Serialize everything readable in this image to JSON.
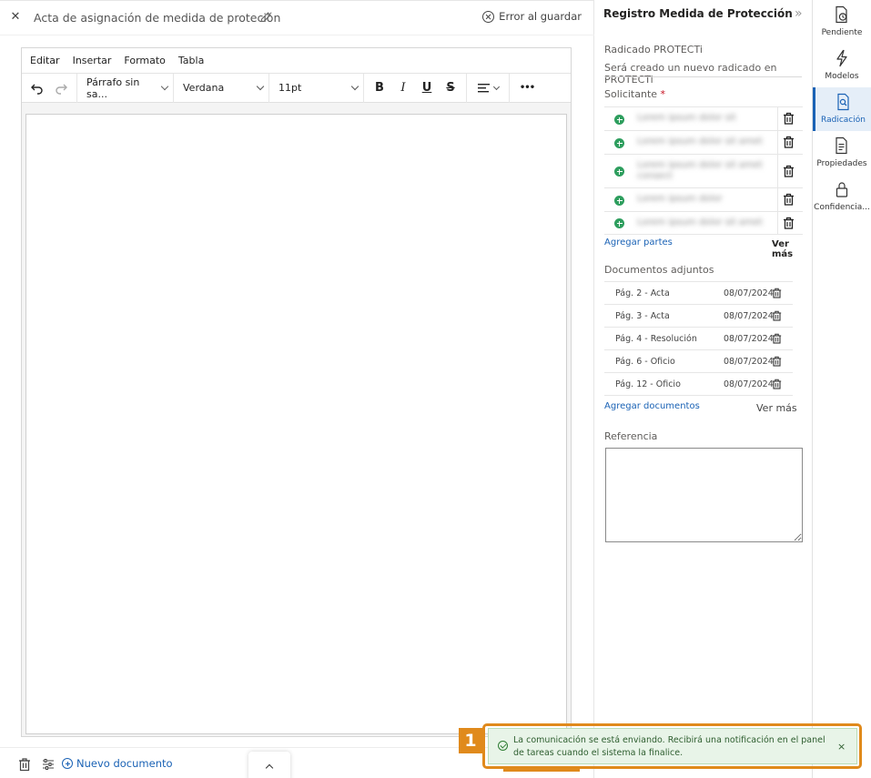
{
  "header": {
    "close_icon": "close-icon",
    "title": "Acta de asignación de medida de proteción",
    "edit_icon": "pencil-icon",
    "save_error": "Error al guardar"
  },
  "editor": {
    "menu": [
      "Editar",
      "Insertar",
      "Formato",
      "Tabla"
    ],
    "paragraph_style": "Párrafo sin sa...",
    "font_family": "Verdana",
    "font_size": "11pt",
    "bold": "B",
    "italic": "I",
    "underline": "U",
    "strikethrough": "S",
    "more": "•••"
  },
  "bottom": {
    "new_document": "Nuevo documento"
  },
  "panel": {
    "title": "Registro Medida de Protección",
    "collapse": "»",
    "radicado_label": "Radicado PROTECTi",
    "radicado_value": "Será creado un nuevo radicado en PROTECTi",
    "solicitante_label": "Solicitante",
    "required_mark": "*",
    "parties": [
      {
        "name": "Lorem ipsum dolor sit"
      },
      {
        "name": "Lorem ipsum dolor sit amet"
      },
      {
        "name": "Lorem ipsum dolor sit amet consect"
      },
      {
        "name": "Lorem ipsum dolor"
      },
      {
        "name": "Lorem ipsum dolor sit amet"
      }
    ],
    "add_parties": "Agregar partes",
    "parties_more": "Ver más",
    "docs_label": "Documentos adjuntos",
    "documents": [
      {
        "name": "Pág. 2 - Acta",
        "date": "08/07/2024"
      },
      {
        "name": "Pág. 3 - Acta",
        "date": "08/07/2024"
      },
      {
        "name": "Pág. 4 - Resolución",
        "date": "08/07/2024"
      },
      {
        "name": "Pág. 6 - Oficio",
        "date": "08/07/2024"
      },
      {
        "name": "Pág. 12 - Oficio",
        "date": "08/07/2024"
      }
    ],
    "add_documents": "Agregar documentos",
    "docs_more": "Ver más",
    "reference_label": "Referencia",
    "reference_value": ""
  },
  "rail": [
    {
      "label": "Pendiente",
      "icon": "clock-document-icon"
    },
    {
      "label": "Modelos",
      "icon": "lightning-icon"
    },
    {
      "label": "Radicación",
      "icon": "document-search-icon"
    },
    {
      "label": "Propiedades",
      "icon": "document-lines-icon"
    },
    {
      "label": "Confidencia...",
      "icon": "lock-icon"
    }
  ],
  "toast": {
    "step": "1",
    "message": "La comunicación se está enviando. Recibirá una notificación en el panel de tareas cuando el sistema la finalice.",
    "close": "×"
  },
  "colors": {
    "accent": "#1a62b5",
    "success": "#2e9e5e",
    "highlight": "#e08a1c",
    "toast_bg": "#e8f4e8"
  }
}
